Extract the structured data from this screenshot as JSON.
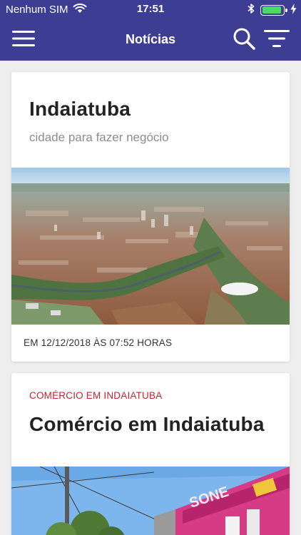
{
  "status_bar": {
    "carrier": "Nenhum SIM",
    "time": "17:51",
    "battery_level": 0.9,
    "battery_color": "#4cd964"
  },
  "app_bar": {
    "title": "Notícias",
    "menu_icon": "hamburger-menu-icon",
    "search_icon": "search-icon",
    "filter_icon": "filter-icon",
    "color": "#3d3d94"
  },
  "feed": {
    "items": [
      {
        "title": "Indaiatuba",
        "subtitle": "cidade para fazer negócio",
        "date": "EM 12/12/2018 ÀS 07:52 HORAS",
        "image": "aerial-city-photo"
      },
      {
        "category": "COMÉRCIO EM INDAIATUBA",
        "title": "Comércio em Indaiatuba",
        "image": "storefront-photo"
      }
    ]
  },
  "colors": {
    "category": "#c0262d",
    "background": "#eeeeee"
  }
}
